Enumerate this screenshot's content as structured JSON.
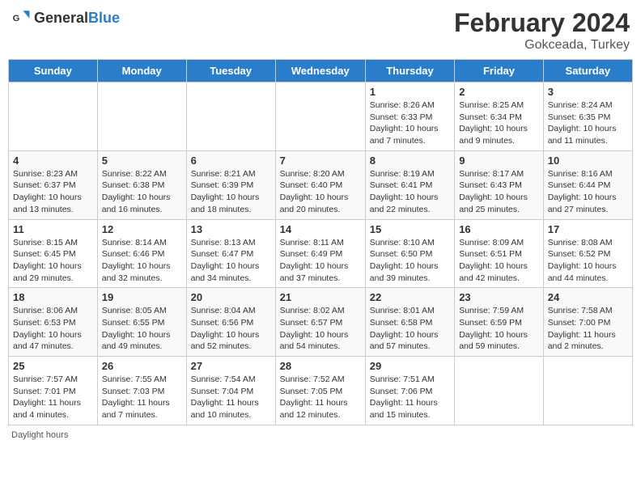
{
  "header": {
    "logo_general": "General",
    "logo_blue": "Blue",
    "month": "February 2024",
    "location": "Gokceada, Turkey"
  },
  "days_of_week": [
    "Sunday",
    "Monday",
    "Tuesday",
    "Wednesday",
    "Thursday",
    "Friday",
    "Saturday"
  ],
  "weeks": [
    [
      {
        "day": null,
        "info": null
      },
      {
        "day": null,
        "info": null
      },
      {
        "day": null,
        "info": null
      },
      {
        "day": null,
        "info": null
      },
      {
        "day": "1",
        "info": "Sunrise: 8:26 AM\nSunset: 6:33 PM\nDaylight: 10 hours and 7 minutes."
      },
      {
        "day": "2",
        "info": "Sunrise: 8:25 AM\nSunset: 6:34 PM\nDaylight: 10 hours and 9 minutes."
      },
      {
        "day": "3",
        "info": "Sunrise: 8:24 AM\nSunset: 6:35 PM\nDaylight: 10 hours and 11 minutes."
      }
    ],
    [
      {
        "day": "4",
        "info": "Sunrise: 8:23 AM\nSunset: 6:37 PM\nDaylight: 10 hours and 13 minutes."
      },
      {
        "day": "5",
        "info": "Sunrise: 8:22 AM\nSunset: 6:38 PM\nDaylight: 10 hours and 16 minutes."
      },
      {
        "day": "6",
        "info": "Sunrise: 8:21 AM\nSunset: 6:39 PM\nDaylight: 10 hours and 18 minutes."
      },
      {
        "day": "7",
        "info": "Sunrise: 8:20 AM\nSunset: 6:40 PM\nDaylight: 10 hours and 20 minutes."
      },
      {
        "day": "8",
        "info": "Sunrise: 8:19 AM\nSunset: 6:41 PM\nDaylight: 10 hours and 22 minutes."
      },
      {
        "day": "9",
        "info": "Sunrise: 8:17 AM\nSunset: 6:43 PM\nDaylight: 10 hours and 25 minutes."
      },
      {
        "day": "10",
        "info": "Sunrise: 8:16 AM\nSunset: 6:44 PM\nDaylight: 10 hours and 27 minutes."
      }
    ],
    [
      {
        "day": "11",
        "info": "Sunrise: 8:15 AM\nSunset: 6:45 PM\nDaylight: 10 hours and 29 minutes."
      },
      {
        "day": "12",
        "info": "Sunrise: 8:14 AM\nSunset: 6:46 PM\nDaylight: 10 hours and 32 minutes."
      },
      {
        "day": "13",
        "info": "Sunrise: 8:13 AM\nSunset: 6:47 PM\nDaylight: 10 hours and 34 minutes."
      },
      {
        "day": "14",
        "info": "Sunrise: 8:11 AM\nSunset: 6:49 PM\nDaylight: 10 hours and 37 minutes."
      },
      {
        "day": "15",
        "info": "Sunrise: 8:10 AM\nSunset: 6:50 PM\nDaylight: 10 hours and 39 minutes."
      },
      {
        "day": "16",
        "info": "Sunrise: 8:09 AM\nSunset: 6:51 PM\nDaylight: 10 hours and 42 minutes."
      },
      {
        "day": "17",
        "info": "Sunrise: 8:08 AM\nSunset: 6:52 PM\nDaylight: 10 hours and 44 minutes."
      }
    ],
    [
      {
        "day": "18",
        "info": "Sunrise: 8:06 AM\nSunset: 6:53 PM\nDaylight: 10 hours and 47 minutes."
      },
      {
        "day": "19",
        "info": "Sunrise: 8:05 AM\nSunset: 6:55 PM\nDaylight: 10 hours and 49 minutes."
      },
      {
        "day": "20",
        "info": "Sunrise: 8:04 AM\nSunset: 6:56 PM\nDaylight: 10 hours and 52 minutes."
      },
      {
        "day": "21",
        "info": "Sunrise: 8:02 AM\nSunset: 6:57 PM\nDaylight: 10 hours and 54 minutes."
      },
      {
        "day": "22",
        "info": "Sunrise: 8:01 AM\nSunset: 6:58 PM\nDaylight: 10 hours and 57 minutes."
      },
      {
        "day": "23",
        "info": "Sunrise: 7:59 AM\nSunset: 6:59 PM\nDaylight: 10 hours and 59 minutes."
      },
      {
        "day": "24",
        "info": "Sunrise: 7:58 AM\nSunset: 7:00 PM\nDaylight: 11 hours and 2 minutes."
      }
    ],
    [
      {
        "day": "25",
        "info": "Sunrise: 7:57 AM\nSunset: 7:01 PM\nDaylight: 11 hours and 4 minutes."
      },
      {
        "day": "26",
        "info": "Sunrise: 7:55 AM\nSunset: 7:03 PM\nDaylight: 11 hours and 7 minutes."
      },
      {
        "day": "27",
        "info": "Sunrise: 7:54 AM\nSunset: 7:04 PM\nDaylight: 11 hours and 10 minutes."
      },
      {
        "day": "28",
        "info": "Sunrise: 7:52 AM\nSunset: 7:05 PM\nDaylight: 11 hours and 12 minutes."
      },
      {
        "day": "29",
        "info": "Sunrise: 7:51 AM\nSunset: 7:06 PM\nDaylight: 11 hours and 15 minutes."
      },
      {
        "day": null,
        "info": null
      },
      {
        "day": null,
        "info": null
      }
    ]
  ],
  "footer": {
    "daylight_label": "Daylight hours"
  }
}
